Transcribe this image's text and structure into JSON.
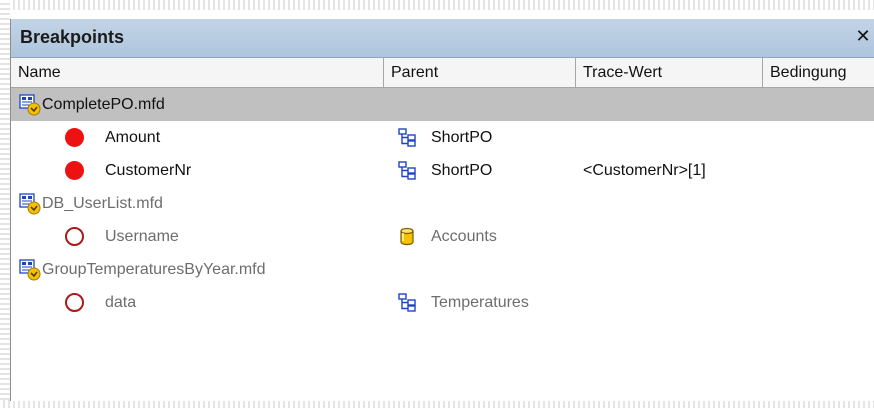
{
  "panel": {
    "title": "Breakpoints",
    "close_glyph": "✕"
  },
  "columns": [
    {
      "label": "Name"
    },
    {
      "label": "Parent"
    },
    {
      "label": "Trace-Wert"
    },
    {
      "label": "Bedingung"
    }
  ],
  "rows": [
    {
      "type": "mapping",
      "name": "CompletePO.mfd",
      "icon": "mapping-file-icon",
      "selected": true
    },
    {
      "type": "breakpoint",
      "name": "Amount",
      "icon": "breakpoint-active-icon",
      "parent": "ShortPO",
      "parent_icon": "schema-structure-icon",
      "trace": ""
    },
    {
      "type": "breakpoint",
      "name": "CustomerNr",
      "icon": "breakpoint-active-icon",
      "parent": "ShortPO",
      "parent_icon": "schema-structure-icon",
      "trace": "<CustomerNr>[1]"
    },
    {
      "type": "mapping",
      "name": "DB_UserList.mfd",
      "icon": "mapping-file-icon"
    },
    {
      "type": "breakpoint",
      "name": "Username",
      "icon": "breakpoint-inactive-icon",
      "parent": "Accounts",
      "parent_icon": "database-icon"
    },
    {
      "type": "mapping",
      "name": "GroupTemperaturesByYear.mfd",
      "icon": "mapping-file-icon"
    },
    {
      "type": "breakpoint",
      "name": "data",
      "icon": "breakpoint-inactive-icon",
      "parent": "Temperatures",
      "parent_icon": "schema-structure-icon"
    }
  ],
  "colors": {
    "titlebar": "#b4c9df",
    "selected_row": "#c0c0c0",
    "breakpoint_active": "#ee1111",
    "breakpoint_inactive": "#aa1a1a",
    "icon_blue": "#1d44c4",
    "icon_yellow": "#f4c300"
  }
}
